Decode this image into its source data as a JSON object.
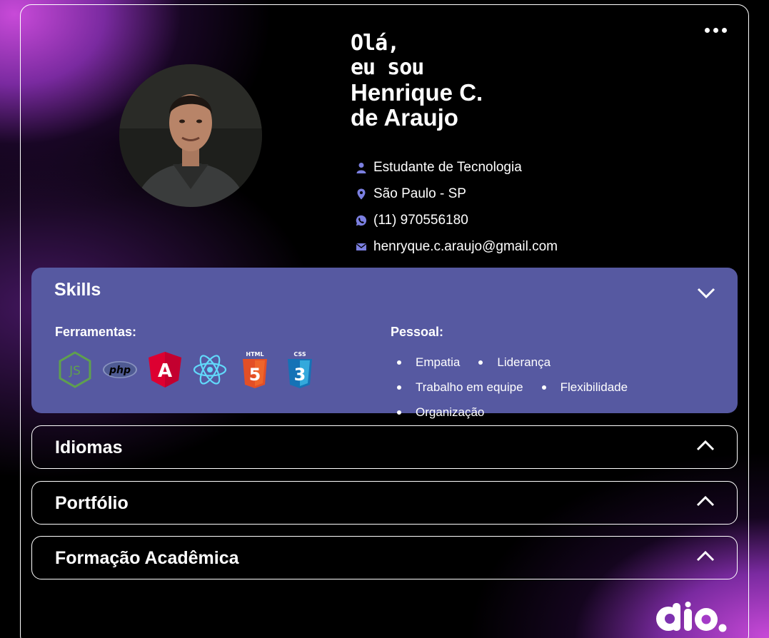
{
  "header": {
    "greeting_line1": "Olá,",
    "greeting_line2": "eu sou",
    "name_line1": "Henrique C.",
    "name_line2": "de Araujo"
  },
  "contact": {
    "role": "Estudante de Tecnologia",
    "location": "São Paulo - SP",
    "phone": "(11) 970556180",
    "email": "henryque.c.araujo@gmail.com"
  },
  "skills": {
    "title": "Skills",
    "tools_label": "Ferramentas:",
    "tools": [
      "nodejs-icon",
      "php-icon",
      "angular-icon",
      "react-icon",
      "html5-icon",
      "css3-icon"
    ],
    "tool_badges": {
      "html": "HTML",
      "css": "CSS",
      "php": "php",
      "angular": "A",
      "html_num": "5",
      "css_num": "3",
      "js": "JS"
    },
    "soft_label": "Pessoal:",
    "soft_skills": [
      "Empatia",
      "Liderança",
      "Trabalho em equipe",
      "Flexibilidade",
      "Organização"
    ]
  },
  "sections": {
    "languages": "Idiomas",
    "portfolio": "Portfólio",
    "education": "Formação Acadêmica"
  },
  "logo": {
    "text": "dio."
  },
  "colors": {
    "accent": "#5659a1",
    "icon": "#7b7fe0",
    "gradient": "#c84ad8"
  }
}
